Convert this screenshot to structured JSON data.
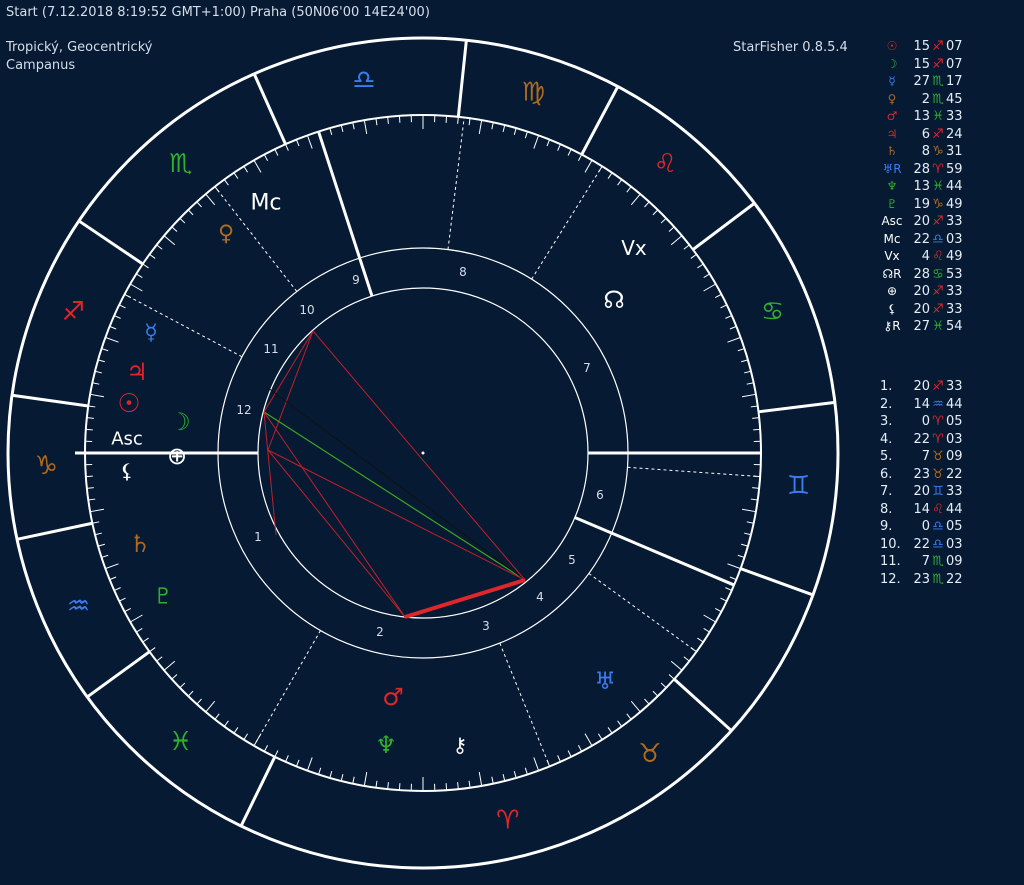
{
  "header": {
    "title": "Start (7.12.2018 8:19:52 GMT+1:00) Praha (50N06'00 14E24'00)",
    "system_line1": "Tropický, Geocentrický",
    "system_line2": "Campanus",
    "version": "StarFisher 0.8.5.4"
  },
  "colors": {
    "background": "#061a33",
    "fire": "#e0262a",
    "earth": "#b06a1e",
    "air": "#3a7cf0",
    "water": "#2fb02f",
    "white": "#ffffff"
  },
  "planets": [
    {
      "name": "sun-icon",
      "glyph": "☉",
      "deg": "15",
      "sign": "♐",
      "sign_el": "fire",
      "min": "07",
      "el": "fire"
    },
    {
      "name": "moon-icon",
      "glyph": "☽",
      "deg": "15",
      "sign": "♐",
      "sign_el": "fire",
      "min": "07",
      "el": "water"
    },
    {
      "name": "mercury-icon",
      "glyph": "☿",
      "deg": "27",
      "sign": "♏",
      "sign_el": "water",
      "min": "17",
      "el": "air"
    },
    {
      "name": "venus-icon",
      "glyph": "♀",
      "deg": "2",
      "sign": "♏",
      "sign_el": "water",
      "min": "45",
      "el": "earth"
    },
    {
      "name": "mars-icon",
      "glyph": "♂",
      "deg": "13",
      "sign": "♓",
      "sign_el": "water",
      "min": "33",
      "el": "fire"
    },
    {
      "name": "jupiter-icon",
      "glyph": "♃",
      "deg": "6",
      "sign": "♐",
      "sign_el": "fire",
      "min": "24",
      "el": "fire"
    },
    {
      "name": "saturn-icon",
      "glyph": "♄",
      "deg": "8",
      "sign": "♑",
      "sign_el": "earth",
      "min": "31",
      "el": "earth"
    },
    {
      "name": "uranus-icon",
      "glyph": "♅R",
      "deg": "28",
      "sign": "♈",
      "sign_el": "fire",
      "min": "59",
      "el": "air"
    },
    {
      "name": "neptune-icon",
      "glyph": "♆",
      "deg": "13",
      "sign": "♓",
      "sign_el": "water",
      "min": "44",
      "el": "water"
    },
    {
      "name": "pluto-icon",
      "glyph": "♇",
      "deg": "19",
      "sign": "♑",
      "sign_el": "earth",
      "min": "49",
      "el": "water"
    },
    {
      "name": "asc-icon",
      "glyph": "Asc",
      "deg": "20",
      "sign": "♐",
      "sign_el": "fire",
      "min": "33",
      "el": "white"
    },
    {
      "name": "mc-icon",
      "glyph": "Mc",
      "deg": "22",
      "sign": "♎",
      "sign_el": "air",
      "min": "03",
      "el": "white"
    },
    {
      "name": "vertex-icon",
      "glyph": "Vx",
      "deg": "4",
      "sign": "♌",
      "sign_el": "fire",
      "min": "49",
      "el": "white"
    },
    {
      "name": "node-icon",
      "glyph": "☊R",
      "deg": "28",
      "sign": "♋",
      "sign_el": "water",
      "min": "53",
      "el": "white"
    },
    {
      "name": "part-of-fortune-icon",
      "glyph": "⊕",
      "deg": "20",
      "sign": "♐",
      "sign_el": "fire",
      "min": "33",
      "el": "white"
    },
    {
      "name": "lilith-icon",
      "glyph": "⚸",
      "deg": "20",
      "sign": "♐",
      "sign_el": "fire",
      "min": "33",
      "el": "white"
    },
    {
      "name": "chiron-icon",
      "glyph": "⚷R",
      "deg": "27",
      "sign": "♓",
      "sign_el": "water",
      "min": "54",
      "el": "white"
    }
  ],
  "houses": [
    {
      "n": "1.",
      "deg": "20",
      "sign": "♐",
      "el": "fire",
      "min": "33"
    },
    {
      "n": "2.",
      "deg": "14",
      "sign": "♒",
      "el": "air",
      "min": "44"
    },
    {
      "n": "3.",
      "deg": "0",
      "sign": "♈",
      "el": "fire",
      "min": "05"
    },
    {
      "n": "4.",
      "deg": "22",
      "sign": "♈",
      "el": "fire",
      "min": "03"
    },
    {
      "n": "5.",
      "deg": "7",
      "sign": "♉",
      "el": "earth",
      "min": "09"
    },
    {
      "n": "6.",
      "deg": "23",
      "sign": "♉",
      "el": "earth",
      "min": "22"
    },
    {
      "n": "7.",
      "deg": "20",
      "sign": "♊",
      "el": "air",
      "min": "33"
    },
    {
      "n": "8.",
      "deg": "14",
      "sign": "♌",
      "el": "fire",
      "min": "44"
    },
    {
      "n": "9.",
      "deg": "0",
      "sign": "♎",
      "el": "air",
      "min": "05"
    },
    {
      "n": "10.",
      "deg": "22",
      "sign": "♎",
      "el": "air",
      "min": "03"
    },
    {
      "n": "11.",
      "deg": "7",
      "sign": "♏",
      "el": "water",
      "min": "09"
    },
    {
      "n": "12.",
      "deg": "23",
      "sign": "♏",
      "el": "water",
      "min": "22"
    }
  ],
  "wheel": {
    "zodiac": [
      {
        "glyph": "♈",
        "el": "fire"
      },
      {
        "glyph": "♉",
        "el": "earth"
      },
      {
        "glyph": "♊",
        "el": "air"
      },
      {
        "glyph": "♋",
        "el": "water"
      },
      {
        "glyph": "♌",
        "el": "fire"
      },
      {
        "glyph": "♍",
        "el": "earth"
      },
      {
        "glyph": "♎",
        "el": "air"
      },
      {
        "glyph": "♏",
        "el": "water"
      },
      {
        "glyph": "♐",
        "el": "fire"
      },
      {
        "glyph": "♑",
        "el": "earth"
      },
      {
        "glyph": "♒",
        "el": "air"
      },
      {
        "glyph": "♓",
        "el": "water"
      }
    ],
    "house_numbers": [
      "1",
      "2",
      "3",
      "4",
      "5",
      "6",
      "7",
      "8",
      "9",
      "10",
      "11",
      "12"
    ],
    "planet_glyphs": [
      {
        "name": "wheel-jupiter-icon",
        "glyph": "♃",
        "el": "fire"
      },
      {
        "name": "wheel-sun-icon",
        "glyph": "☉",
        "el": "fire"
      },
      {
        "name": "wheel-moon-icon",
        "glyph": "☽",
        "el": "water"
      },
      {
        "name": "wheel-asc-label",
        "glyph": "Asc",
        "el": "white"
      },
      {
        "name": "wheel-lilith-icon",
        "glyph": "⚸",
        "el": "white"
      },
      {
        "name": "wheel-fortune-icon",
        "glyph": "⊕",
        "el": "white"
      },
      {
        "name": "wheel-mercury-icon",
        "glyph": "☿",
        "el": "air"
      },
      {
        "name": "wheel-venus-icon",
        "glyph": "♀",
        "el": "earth"
      },
      {
        "name": "wheel-mc-label",
        "glyph": "Mc",
        "el": "white"
      },
      {
        "name": "wheel-vertex-label",
        "glyph": "Vx",
        "el": "white"
      },
      {
        "name": "wheel-node-icon",
        "glyph": "☊",
        "el": "white"
      },
      {
        "name": "wheel-saturn-icon",
        "glyph": "♄",
        "el": "earth"
      },
      {
        "name": "wheel-pluto-icon",
        "glyph": "♇",
        "el": "water"
      },
      {
        "name": "wheel-mars-icon",
        "glyph": "♂",
        "el": "fire"
      },
      {
        "name": "wheel-neptune-icon",
        "glyph": "♆",
        "el": "water"
      },
      {
        "name": "wheel-chiron-icon",
        "glyph": "⚷",
        "el": "white"
      },
      {
        "name": "wheel-uranus-icon",
        "glyph": "♅",
        "el": "air"
      }
    ]
  }
}
